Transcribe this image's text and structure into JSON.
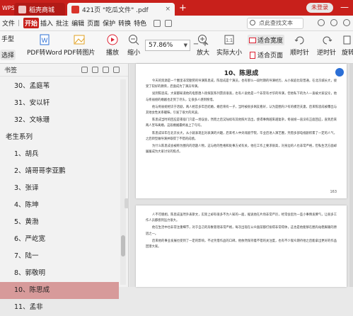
{
  "titlebar": {
    "app_label": "WPS",
    "home_tab": "稻壳商城",
    "doc_tab": "421页 \"吃瓜文件\" .pdf",
    "close_glyph": "×",
    "add_glyph": "+",
    "login": "未登录",
    "minimize": "—"
  },
  "menubar": {
    "file": "文件",
    "items": [
      "开始",
      "插入",
      "批注",
      "编辑",
      "页面",
      "保护",
      "转换",
      "特色"
    ],
    "search_placeholder": "点此查找文本"
  },
  "toolbar": {
    "hand_tool": "手型",
    "select_tool": "选择",
    "pdf_to_word": "PDF转Word",
    "pdf_to_image": "PDF转图片",
    "play": "播放",
    "zoom_out": "缩小",
    "zoom_value": "57.86%",
    "zoom_in": "放大",
    "actual_size": "实际大小",
    "fit_width": "适合宽度",
    "fit_page": "适合页面",
    "rotate_cw": "顺时针",
    "rotate_ccw": "逆时针",
    "rotate_doc": "旋转"
  },
  "sidebar": {
    "title": "书签",
    "items": [
      {
        "label": "30、孟庭苇"
      },
      {
        "label": "31、安以轩"
      },
      {
        "label": "32、文咏珊"
      },
      {
        "label": "老生系列"
      },
      {
        "label": "1、胡兵"
      },
      {
        "label": "2、靖哥哥李亚鹏"
      },
      {
        "label": "3、张译"
      },
      {
        "label": "4、陈坤"
      },
      {
        "label": "5、黄渤"
      },
      {
        "label": "6、严屹宽"
      },
      {
        "label": "7、陆一"
      },
      {
        "label": "8、郭敬明"
      },
      {
        "label": "10、陈思成"
      },
      {
        "label": "11、孟非"
      }
    ]
  },
  "document": {
    "page_title": "10、陈思成",
    "paragraphs": [
      "今天的资源是一个圈里非常勤劳的导演陈思成，陈思成是个演员，也有那么一段时期的导演经历，从小家庭比较普通，在北京城长大，接受了较好的教育，后面成为了演员导演。",
      "说到陈思成，大家都知道他的电影唐人街探案系列票房很高，也有人说他是一个非常有才华的导演，但他私下的为人一直被大家议论，他与佟丽娅的婚姻也走到了尽头，让很多人感到惋惜。",
      "他与佟丽娅相识于话剧，两人相恋多年后结婚，婚后育有一子，当时被很多网友看好，认为是圈内少有的模范夫妻，后来陈思成被曝出与其他女性关系暧昧，引发了很大的风波。",
      "陈思成当时的回应是夜宿门只是一场误会，然而之后又陆续有其他照片流出，使得事情越来越复杂，佟丽娅一直没有正面回应，直到后来两人宣布离婚，这段婚姻最终画上了句号。",
      "陈思成早年在北京长大，从小就表现出对表演的兴趣，后来考入中央戏剧学院，毕业后进入演艺圈，凭借多部电视剧积累了一定的人气，之后转型做导演并取得了不错的成绩。",
      "为什么陈思成会被称为圈内的话题人物，这与他的性格和处事方式有关，他在工作上要求很高，对身边的人也非常严格，但私生活方面却屡屡成为大家讨论的焦点。"
    ],
    "page_number": "163",
    "page2_paragraphs": [
      "人不可貌相，陈思成虽然外表斯文，实际上却有很多不为人知的一面，据说他在片场非常严厉，经常会因为一些小事情发脾气，让很多工作人员都感到压力很大。",
      "他在生活中也非常注重细节，对于自己的形象管理非常严格，每次出现在公众面前都打扮得非常得体，这也是他能够在圈内站稳脚跟的原因之一。",
      "后来他的事业发展也受到了一定的影响，不过凭借作品的口碑，他依然保持着不错的关注度，也有不少观众期待他之后能拿出更好的作品回馈大家。"
    ]
  }
}
